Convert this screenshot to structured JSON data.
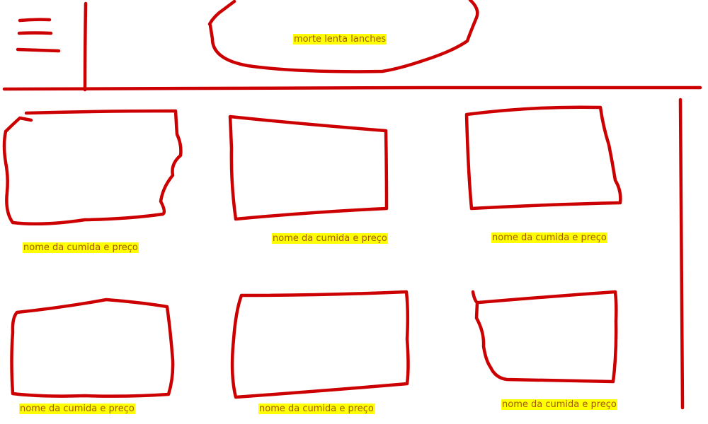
{
  "colors": {
    "ink": "#cc0000",
    "highlight": "#ffff00",
    "label_text": "#a15a00",
    "background": "#ffffff"
  },
  "header": {
    "menu_icon": "hamburger-menu-icon",
    "title": "morte lenta lanches"
  },
  "products": [
    {
      "label": "nome da cumida e preço"
    },
    {
      "label": "nome da cumida e preço"
    },
    {
      "label": "nome da cumida e preço"
    },
    {
      "label": "nome da cumida e preço"
    },
    {
      "label": "nome da cumida e preço"
    },
    {
      "label": "nome da cumida e preço"
    }
  ]
}
